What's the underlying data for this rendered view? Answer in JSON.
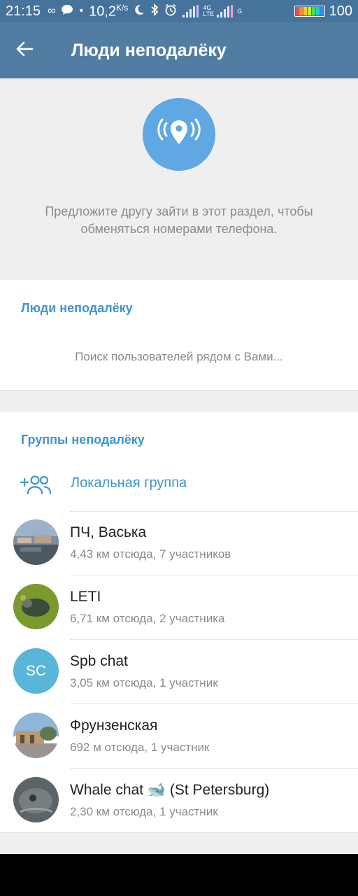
{
  "status_bar": {
    "time": "21:15",
    "speed": "10,2",
    "speed_unit": "K/s",
    "net_4g": "4G",
    "net_lte": "LTE",
    "net_g": "G",
    "battery_level": "100"
  },
  "toolbar": {
    "title": "Люди неподалёку"
  },
  "intro": {
    "description": "Предложите другу зайти в этот раздел, чтобы обменяться номерами телефона."
  },
  "people_nearby": {
    "header": "Люди неподалёку",
    "searching_text": "Поиск пользователей рядом с Вами..."
  },
  "groups_nearby": {
    "header": "Группы неподалёку",
    "local_group_label": "Локальная группа",
    "groups": [
      {
        "name": "ПЧ, Васька",
        "meta": "4,43 км отсюда, 7 участников"
      },
      {
        "name": "LETI",
        "meta": "6,71 км отсюда, 2 участника"
      },
      {
        "name": "Spb chat",
        "meta": "3,05 км отсюда, 1 участник",
        "initials": "SC"
      },
      {
        "name": "Фрунзенская",
        "meta": "692 м отсюда, 1 участник"
      },
      {
        "name": "Whale chat 🐋 (St Petersburg)",
        "meta": "2,30 км отсюда, 1 участник"
      }
    ]
  },
  "colors": {
    "toolbar": "#527da3",
    "status_bar": "#46739c",
    "accent": "#3d95cc",
    "pin_circle": "#5fa8e3",
    "spb_avatar": "#58b6d8"
  }
}
